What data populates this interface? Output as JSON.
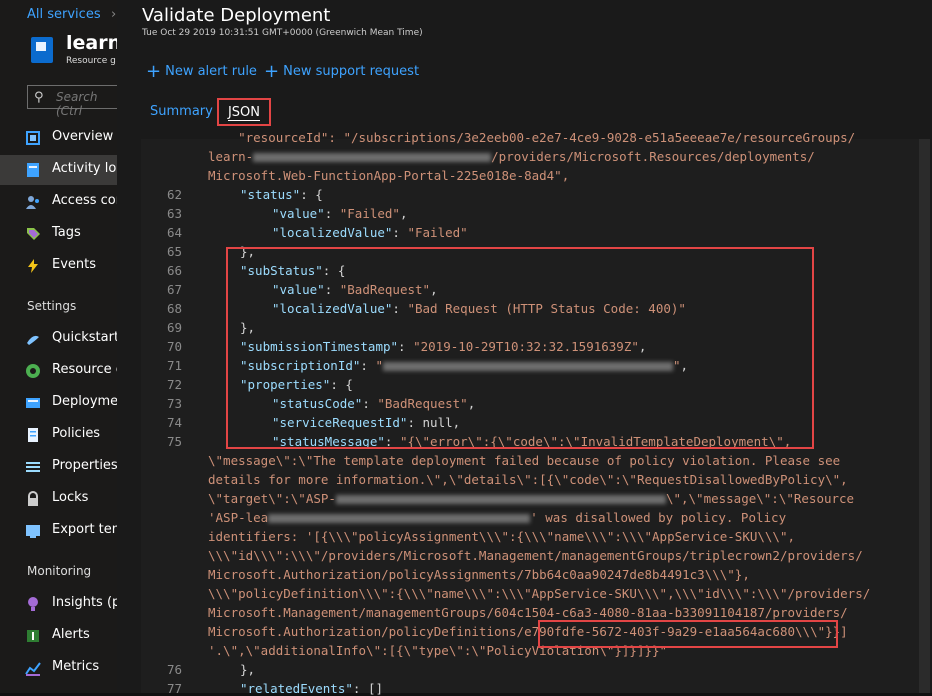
{
  "breadcrumb": {
    "all_services": "All services",
    "next": "›"
  },
  "resource": {
    "title": "learn-",
    "subtitle": "Resource g"
  },
  "search": {
    "placeholder": "Search (Ctrl"
  },
  "nav": [
    {
      "label": "Overview",
      "icon": "overview-icon"
    },
    {
      "label": "Activity log",
      "icon": "activity-log-icon"
    },
    {
      "label": "Access cont",
      "icon": "access-control-icon"
    },
    {
      "label": "Tags",
      "icon": "tag-icon"
    },
    {
      "label": "Events",
      "icon": "events-bolt-icon"
    }
  ],
  "settings_label": "Settings",
  "settings": [
    {
      "label": "Quickstart",
      "icon": "quickstart-icon"
    },
    {
      "label": "Resource c",
      "icon": "resource-costs-icon"
    },
    {
      "label": "Deploymen",
      "icon": "deployments-icon"
    },
    {
      "label": "Policies",
      "icon": "policies-icon"
    },
    {
      "label": "Properties",
      "icon": "properties-icon"
    },
    {
      "label": "Locks",
      "icon": "lock-icon"
    },
    {
      "label": "Export tem",
      "icon": "export-template-icon"
    }
  ],
  "monitoring_label": "Monitoring",
  "monitoring": [
    {
      "label": "Insights (pr",
      "icon": "insights-icon"
    },
    {
      "label": "Alerts",
      "icon": "alerts-icon"
    },
    {
      "label": "Metrics",
      "icon": "metrics-icon"
    }
  ],
  "panel": {
    "title": "Validate Deployment",
    "timestamp": "Tue Oct 29 2019 10:31:51 GMT+0000 (Greenwich Mean Time)",
    "new_alert_rule": "New alert rule",
    "new_support_request": "New support request",
    "tab_summary": "Summary",
    "tab_json": "JSON"
  },
  "code": {
    "l0": "    \"resourceId\": \"/subscriptions/3e2eeb00-e2e7-4ce9-9028-e51a5eeeae7e/resourceGroups/",
    "l1a": "learn-",
    "l1b": "/providers/Microsoft.Resources/deployments/",
    "l2": "Microsoft.Web-FunctionApp-Portal-225e018e-8ad4\",",
    "n62": "62",
    "l62k": "\"status\"",
    "l62r": ": {",
    "n63": "63",
    "l63k": "\"value\"",
    "l63v": "\"Failed\"",
    "n64": "64",
    "l64k": "\"localizedValue\"",
    "l64v": "\"Failed\"",
    "n65": "65",
    "l65": "},",
    "n66": "66",
    "l66k": "\"subStatus\"",
    "l66r": ": {",
    "n67": "67",
    "l67k": "\"value\"",
    "l67v": "\"BadRequest\"",
    "n68": "68",
    "l68k": "\"localizedValue\"",
    "l68v": "\"Bad Request (HTTP Status Code: 400)\"",
    "n69": "69",
    "l69": "},",
    "n70": "70",
    "l70k": "\"submissionTimestamp\"",
    "l70v": "\"2019-10-29T10:32:32.1591639Z\"",
    "n71": "71",
    "l71k": "\"subscriptionId\"",
    "l71v": "\"",
    "n72": "72",
    "l72k": "\"properties\"",
    "l72r": ": {",
    "n73": "73",
    "l73k": "\"statusCode\"",
    "l73v": "\"BadRequest\"",
    "n74": "74",
    "l74k": "\"serviceRequestId\"",
    "l74v": "null",
    "n75": "75",
    "l75k": "\"statusMessage\"",
    "l75v": "\"{\\\"error\\\":{\\\"code\\\":\\\"InvalidTemplateDeployment\\\",",
    "w1": "\\\"message\\\":\\\"The template deployment failed because of policy violation. Please see",
    "w2": "details for more information.\\\",\\\"details\\\":[{\\\"code\\\":\\\"RequestDisallowedByPolicy\\\",",
    "w3a": "\\\"target\\\":\\\"ASP-",
    "w3b": "\\\",\\\"message\\\":\\\"Resource",
    "w4a": "'ASP-lea",
    "w4b": "' was disallowed by policy. Policy",
    "w5": "identifiers: '[{\\\\\\\"policyAssignment\\\\\\\":{\\\\\\\"name\\\\\\\":\\\\\\\"AppService-SKU\\\\\\\",",
    "w6": "\\\\\\\"id\\\\\\\":\\\\\\\"/providers/Microsoft.Management/managementGroups/triplecrown2/providers/",
    "w7": "Microsoft.Authorization/policyAssignments/7bb64c0aa90247de8b4491c3\\\\\\\"},",
    "w8": "\\\\\\\"policyDefinition\\\\\\\":{\\\\\\\"name\\\\\\\":\\\\\\\"AppService-SKU\\\\\\\",\\\\\\\"id\\\\\\\":\\\\\\\"/providers/",
    "w9": "Microsoft.Management/managementGroups/604c1504-c6a3-4080-81aa-b33091104187/providers/",
    "w10a": "Microsoft.Authorization/policyDefinitions/",
    "w10b": "e790fdfe-5672-403f-9a29-e1aa564ac680",
    "w10c": "\\\\\\\"}}]",
    "w11": "'.\\\",\\\"additionalInfo\\\":[{\\\"type\\\":\\\"PolicyViolation\\\"}]}]}}\"",
    "n76": "76",
    "l76": "},",
    "n77": "77",
    "l77k": "\"relatedEvents\"",
    "l77v": ": []"
  }
}
